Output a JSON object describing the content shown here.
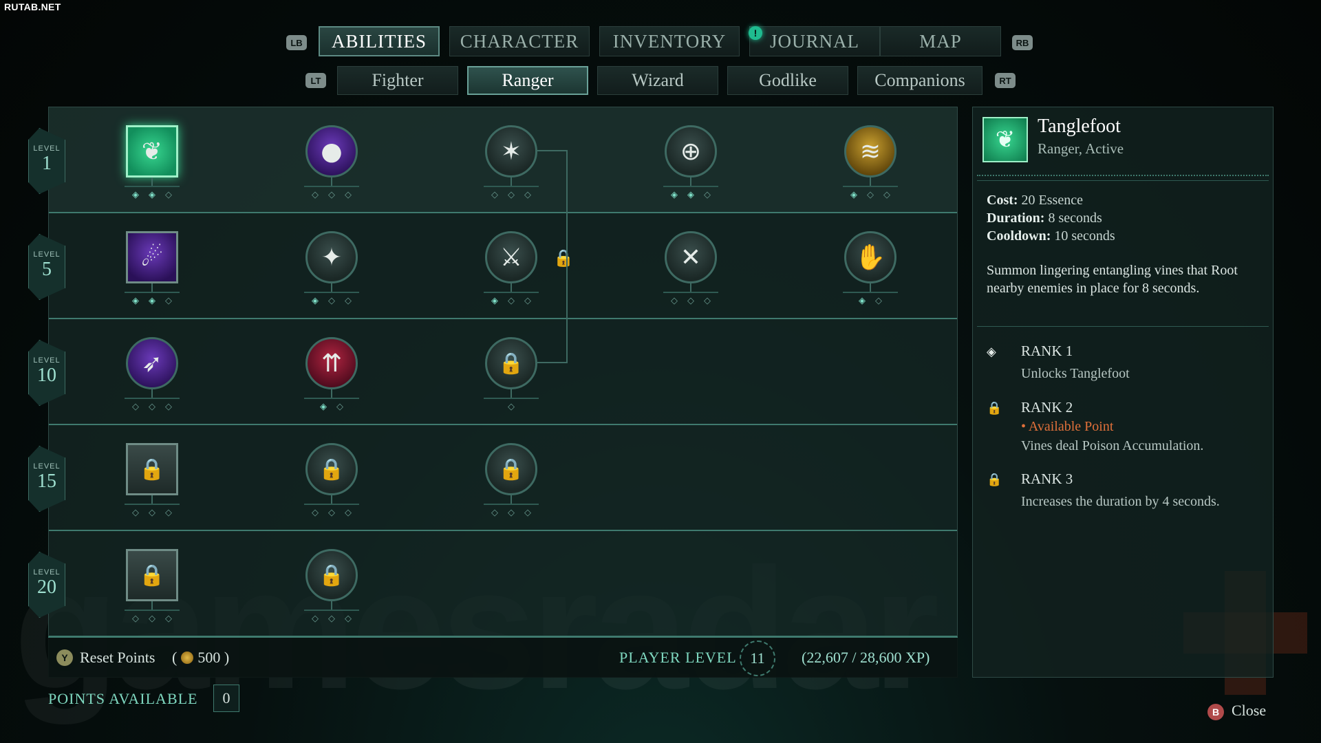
{
  "watermark": "RUTAB.NET",
  "background_mark": "gamesradar",
  "shoulder_buttons": {
    "lb": "LB",
    "rb": "RB",
    "lt": "LT",
    "rt": "RT"
  },
  "tabs": [
    {
      "label": "ABILITIES",
      "active": true
    },
    {
      "label": "CHARACTER",
      "active": false
    },
    {
      "label": "INVENTORY",
      "active": false
    },
    {
      "label": "JOURNAL",
      "active": false,
      "notification": "!"
    },
    {
      "label": "MAP",
      "active": false
    }
  ],
  "subtabs": [
    {
      "label": "Fighter",
      "active": false
    },
    {
      "label": "Ranger",
      "active": true
    },
    {
      "label": "Wizard",
      "active": false
    },
    {
      "label": "Godlike",
      "active": false
    },
    {
      "label": "Companions",
      "active": false
    }
  ],
  "level_caption": "LEVEL",
  "rows": [
    {
      "level": "1",
      "nodes": [
        {
          "icon": "tanglefoot-icon",
          "shape": "square",
          "style": "selected",
          "ranks": [
            1,
            1,
            0
          ]
        },
        {
          "icon": "essence-orbs-icon",
          "shape": "circle",
          "style": "purple",
          "ranks": [
            0,
            0,
            0
          ]
        },
        {
          "icon": "shattered-arrow-icon",
          "shape": "circle",
          "style": "normal",
          "ranks": [
            0,
            0,
            0
          ]
        },
        {
          "icon": "crosshair-bow-icon",
          "shape": "circle",
          "style": "normal",
          "ranks": [
            1,
            1,
            0
          ]
        },
        {
          "icon": "swift-claws-icon",
          "shape": "circle",
          "style": "gold",
          "ranks": [
            1,
            0,
            0
          ]
        }
      ]
    },
    {
      "level": "5",
      "nodes": [
        {
          "icon": "dash-figure-icon",
          "shape": "square",
          "style": "purple",
          "ranks": [
            1,
            1,
            0
          ]
        },
        {
          "icon": "piercing-blade-icon",
          "shape": "circle",
          "style": "normal",
          "ranks": [
            1,
            0,
            0
          ]
        },
        {
          "icon": "dual-weapons-icon",
          "shape": "circle",
          "style": "normal",
          "ranks": [
            1,
            0,
            0
          ]
        },
        {
          "icon": "crossed-swords-icon",
          "shape": "circle",
          "style": "normal",
          "ranks": [
            0,
            0,
            0
          ]
        },
        {
          "icon": "leaf-hand-icon",
          "shape": "circle",
          "style": "normal",
          "ranks": [
            1,
            0
          ]
        }
      ]
    },
    {
      "level": "10",
      "nodes": [
        {
          "icon": "sprint-icon",
          "shape": "circle",
          "style": "purple",
          "ranks": [
            0,
            0,
            0
          ]
        },
        {
          "icon": "triple-arrows-icon",
          "shape": "circle",
          "style": "red",
          "ranks": [
            1,
            0
          ]
        },
        {
          "icon": "lock-icon",
          "shape": "circle",
          "style": "locked",
          "ranks": [
            0
          ]
        }
      ]
    },
    {
      "level": "15",
      "nodes": [
        {
          "icon": "lock-icon",
          "shape": "square",
          "style": "locked",
          "ranks": [
            0,
            0,
            0
          ]
        },
        {
          "icon": "lock-icon",
          "shape": "circle",
          "style": "locked",
          "ranks": [
            0,
            0,
            0
          ]
        },
        {
          "icon": "lock-icon",
          "shape": "circle",
          "style": "locked",
          "ranks": [
            0,
            0,
            0
          ]
        }
      ]
    },
    {
      "level": "20",
      "nodes": [
        {
          "icon": "lock-icon",
          "shape": "square",
          "style": "locked",
          "ranks": [
            0,
            0,
            0
          ]
        },
        {
          "icon": "lock-icon",
          "shape": "circle",
          "style": "locked",
          "ranks": [
            0,
            0,
            0
          ]
        }
      ]
    }
  ],
  "footer": {
    "y_button": "Y",
    "reset_label": "Reset Points",
    "reset_cost_open": "(",
    "reset_cost": "500",
    "reset_cost_close": ")",
    "player_level_label": "PLAYER LEVEL",
    "player_level": "11",
    "xp": "(22,607 / 28,600 XP)",
    "points_label": "POINTS AVAILABLE",
    "points_value": "0"
  },
  "detail": {
    "title": "Tanglefoot",
    "subtitle": "Ranger, Active",
    "stats": [
      {
        "label": "Cost:",
        "value": "20 Essence"
      },
      {
        "label": "Duration:",
        "value": "8 seconds"
      },
      {
        "label": "Cooldown:",
        "value": "10 seconds"
      }
    ],
    "description": "Summon lingering entangling vines that Root nearby enemies in place for 8 seconds.",
    "ranks": [
      {
        "title": "RANK 1",
        "icon": "diamond-icon",
        "note": "",
        "desc": "Unlocks Tanglefoot"
      },
      {
        "title": "RANK 2",
        "icon": "lock-icon",
        "note": "• Available Point",
        "desc": "Vines deal Poison Accumulation."
      },
      {
        "title": "RANK 3",
        "icon": "lock-icon",
        "note": "",
        "desc": "Increases the duration by 4 seconds."
      }
    ]
  },
  "close": {
    "button": "B",
    "label": "Close"
  },
  "colors": {
    "accent": "#7fd8c0",
    "selected": "#36c98a",
    "locked": "#e08a2c",
    "available": "#e0703a"
  }
}
